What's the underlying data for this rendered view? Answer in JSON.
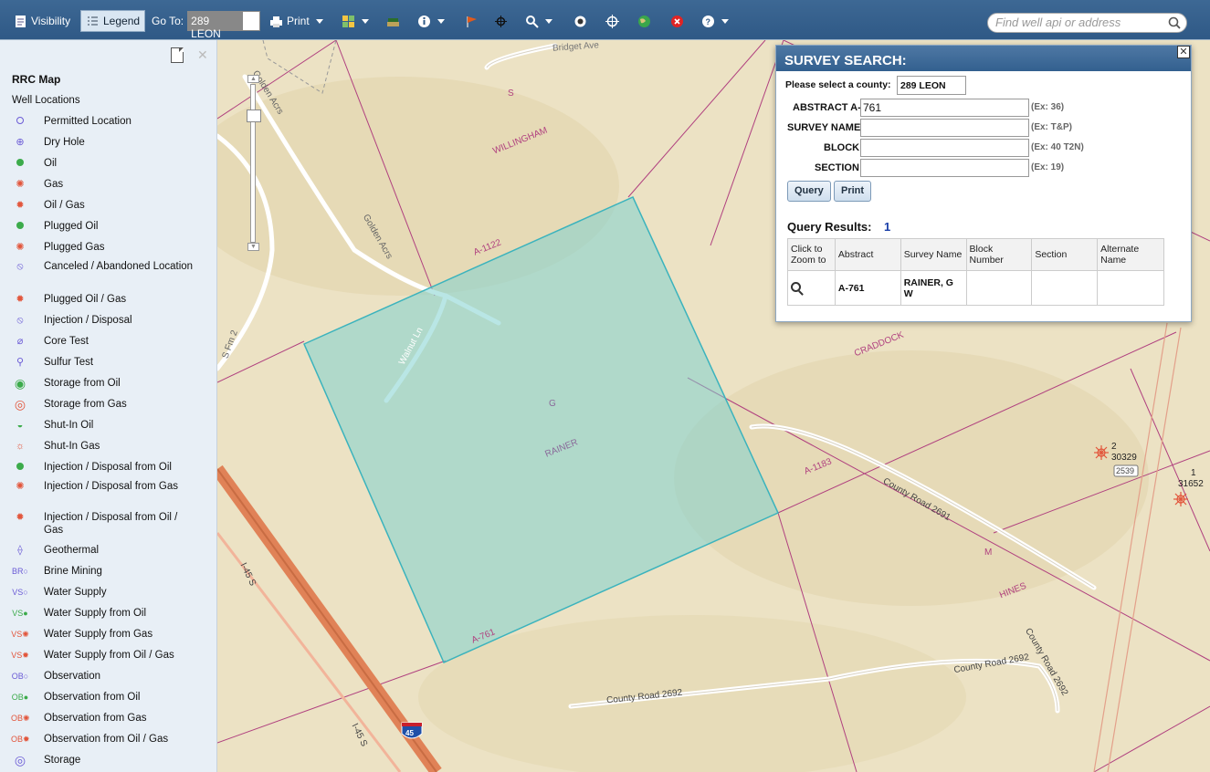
{
  "toolbar": {
    "visibility": "Visibility",
    "legend": "Legend",
    "goto_label": "Go To:",
    "goto_value": "289 LEON",
    "print": "Print",
    "search_placeholder": "Find well api or address"
  },
  "legend": {
    "title": "RRC Map",
    "section": "Well Locations",
    "items": [
      {
        "label": "Permitted Location",
        "icon": "permitted-location-icon"
      },
      {
        "label": "Dry Hole",
        "icon": "dry-hole-icon"
      },
      {
        "label": "Oil",
        "icon": "oil-icon"
      },
      {
        "label": "Gas",
        "icon": "gas-icon"
      },
      {
        "label": "Oil / Gas",
        "icon": "oil-gas-icon"
      },
      {
        "label": "Plugged Oil",
        "icon": "plugged-oil-icon"
      },
      {
        "label": "Plugged Gas",
        "icon": "plugged-gas-icon"
      },
      {
        "label": "Canceled / Abandoned Location",
        "icon": "canceled-location-icon"
      },
      {
        "label": "Plugged Oil / Gas",
        "icon": "plugged-oil-gas-icon"
      },
      {
        "label": "Injection / Disposal",
        "icon": "injection-disposal-icon"
      },
      {
        "label": "Core Test",
        "icon": "core-test-icon"
      },
      {
        "label": "Sulfur Test",
        "icon": "sulfur-test-icon"
      },
      {
        "label": "Storage from Oil",
        "icon": "storage-oil-icon"
      },
      {
        "label": "Storage from Gas",
        "icon": "storage-gas-icon"
      },
      {
        "label": "Shut-In Oil",
        "icon": "shut-in-oil-icon"
      },
      {
        "label": "Shut-In Gas",
        "icon": "shut-in-gas-icon"
      },
      {
        "label": "Injection / Disposal from Oil",
        "icon": "injection-oil-icon"
      },
      {
        "label": "Injection / Disposal from Gas",
        "icon": "injection-gas-icon"
      },
      {
        "label": "Injection / Disposal from Oil / Gas",
        "icon": "injection-oil-gas-icon"
      },
      {
        "label": "Geothermal",
        "icon": "geothermal-icon"
      },
      {
        "label": "Brine Mining",
        "icon": "brine-mining-icon"
      },
      {
        "label": "Water Supply",
        "icon": "water-supply-icon"
      },
      {
        "label": "Water Supply from Oil",
        "icon": "water-supply-oil-icon"
      },
      {
        "label": "Water Supply from Gas",
        "icon": "water-supply-gas-icon"
      },
      {
        "label": "Water Supply from Oil / Gas",
        "icon": "water-supply-oil-gas-icon"
      },
      {
        "label": "Observation",
        "icon": "observation-icon"
      },
      {
        "label": "Observation from Oil",
        "icon": "observation-oil-icon"
      },
      {
        "label": "Observation from Gas",
        "icon": "observation-gas-icon"
      },
      {
        "label": "Observation from Oil / Gas",
        "icon": "observation-oil-gas-icon"
      },
      {
        "label": "Storage",
        "icon": "storage-icon"
      }
    ]
  },
  "map": {
    "labels": {
      "bridget": "Bridget Ave",
      "s": "S",
      "willingham": "WILLINGHAM",
      "golden1": "Golden Acrs",
      "golden2": "Golden Acrs",
      "a1122": "A-1122",
      "walnut": "Walnut Ln",
      "sfm": "S Fm 2",
      "rainer": "RAINER",
      "g": "G",
      "craddock": "CRADDOCK",
      "a1183": "A-1183",
      "cr2691": "County Road 2691",
      "m": "M",
      "hines": "HINES",
      "i45a": "I-45 S",
      "i45b": "I-45 S",
      "shield": "45",
      "a761": "A-761",
      "cr2692a": "County Road 2692",
      "cr2692b": "County Road 2692",
      "well1_num": "2",
      "well1_api": "30329",
      "box2539": "2539",
      "well2_num": "1",
      "well2_api": "31652"
    }
  },
  "dialog": {
    "title": "SURVEY SEARCH:",
    "county_label": "Please select a county:",
    "county_value": "289 LEON",
    "fields": {
      "abstract_label": "ABSTRACT A-",
      "abstract_value": "761",
      "abstract_ex": "(Ex: 36)",
      "survey_label": "SURVEY NAME",
      "survey_ex": "(Ex: T&P)",
      "block_label": "BLOCK",
      "block_ex": "(Ex: 40 T2N)",
      "section_label": "SECTION",
      "section_ex": "(Ex: 19)"
    },
    "query_btn": "Query",
    "print_btn": "Print",
    "results_label": "Query Results:",
    "results_count": "1",
    "columns": [
      "Click to Zoom to",
      "Abstract",
      "Survey Name",
      "Block Number",
      "Section",
      "Alternate Name"
    ],
    "rows": [
      {
        "abstract": "A-761",
        "survey": "RAINER, G W",
        "block": "",
        "section": "",
        "alternate": ""
      }
    ]
  }
}
